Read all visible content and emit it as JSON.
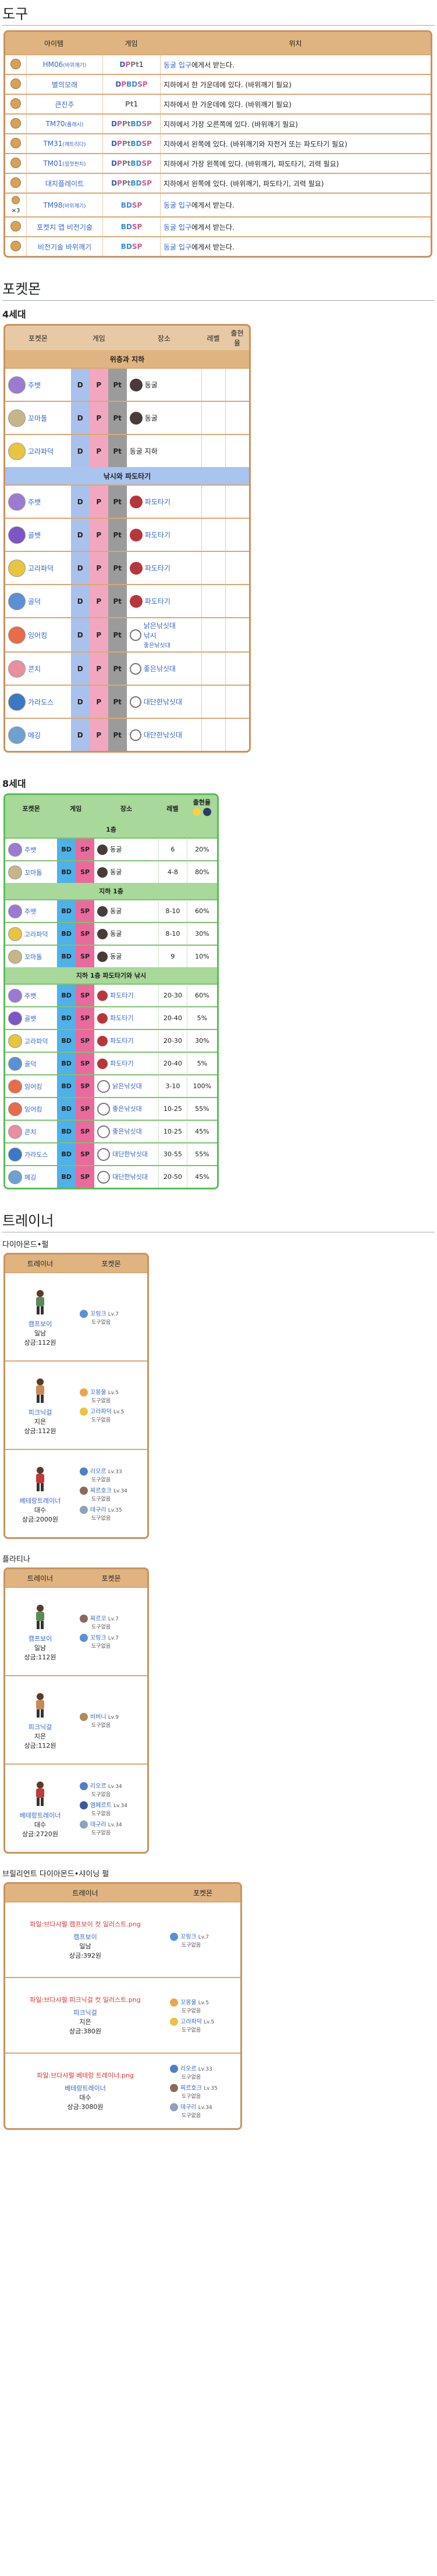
{
  "section_items": "도구",
  "items_table": {
    "headers": [
      "아이템",
      "게임",
      "위치"
    ],
    "rows": [
      {
        "name": "HM06",
        "sub": "(바위깨기)",
        "games": [
          {
            "g": "D",
            "c": "g-d"
          },
          {
            "g": "P",
            "c": "g-p"
          },
          {
            "g": "Pt",
            "c": "g-pt"
          },
          {
            "g": "1",
            "c": ""
          }
        ],
        "loc": "동굴 입구",
        "loc_link": "동굴입구",
        "loc_text": "에게서 받는다."
      },
      {
        "name": "별의모래",
        "sub": "",
        "games": [
          {
            "g": "D",
            "c": "g-d"
          },
          {
            "g": "P",
            "c": "g-p"
          },
          {
            "g": "BD",
            "c": "g-bd"
          },
          {
            "g": "SP",
            "c": "g-sp"
          }
        ],
        "loc_text": "지하에서 한 가운데에 있다. (바위깨기 필요)"
      },
      {
        "name": "큰진주",
        "sub": "",
        "games": [
          {
            "g": "Pt",
            "c": "g-pt"
          },
          {
            "g": "1",
            "c": ""
          }
        ],
        "loc_text": "지하에서 한 가운데에 있다. (바위깨기 필요)"
      },
      {
        "name": "TM70",
        "sub": "(플래시)",
        "games": [
          {
            "g": "D",
            "c": "g-d"
          },
          {
            "g": "P",
            "c": "g-p"
          },
          {
            "g": "Pt",
            "c": "g-pt"
          },
          {
            "g": "BD",
            "c": "g-bd"
          },
          {
            "g": "SP",
            "c": "g-sp"
          }
        ],
        "loc_text": "지하에서 가장 오른쪽에 있다. (바위깨기 필요)"
      },
      {
        "name": "TM31",
        "sub": "(깨트리다)",
        "games": [
          {
            "g": "D",
            "c": "g-d"
          },
          {
            "g": "P",
            "c": "g-p"
          },
          {
            "g": "Pt",
            "c": "g-pt"
          },
          {
            "g": "BD",
            "c": "g-bd"
          },
          {
            "g": "SP",
            "c": "g-sp"
          }
        ],
        "loc_text": "지하에서 왼쪽에 있다. (바위깨기와 자전거 또는 파도타기 필요)"
      },
      {
        "name": "TM01",
        "sub": "(힘껏펀치)",
        "games": [
          {
            "g": "D",
            "c": "g-d"
          },
          {
            "g": "P",
            "c": "g-p"
          },
          {
            "g": "Pt",
            "c": "g-pt"
          },
          {
            "g": "BD",
            "c": "g-bd"
          },
          {
            "g": "SP",
            "c": "g-sp"
          }
        ],
        "loc_text": "지하에서 가장 왼쪽에 있다. (바위깨기, 파도타기, 괴력 필요)"
      },
      {
        "name": "대지플레이트",
        "sub": "",
        "games": [
          {
            "g": "D",
            "c": "g-d"
          },
          {
            "g": "P",
            "c": "g-p"
          },
          {
            "g": "Pt",
            "c": "g-pt"
          },
          {
            "g": "BD",
            "c": "g-bd"
          },
          {
            "g": "SP",
            "c": "g-sp"
          }
        ],
        "loc_text": "지하에서 왼쪽에 있다. (바위깨기, 파도타기, 괴력 필요)"
      },
      {
        "name": "TM98",
        "sub": "(바위깨기)",
        "games": [
          {
            "g": "BD",
            "c": "g-bd"
          },
          {
            "g": "SP",
            "c": "g-sp"
          }
        ],
        "loc": "동굴 입구",
        "loc_text": "에게서 받는다.",
        "prefix": "×3"
      },
      {
        "name": "포켓치 앱 비전기술",
        "sub": "",
        "games": [
          {
            "g": "BD",
            "c": "g-bd"
          },
          {
            "g": "SP",
            "c": "g-sp"
          }
        ],
        "loc": "동굴 입구",
        "loc_text": "에게서 받는다."
      },
      {
        "name": "비전기술 바위깨기",
        "sub": "",
        "games": [
          {
            "g": "BD",
            "c": "g-bd"
          },
          {
            "g": "SP",
            "c": "g-sp"
          }
        ],
        "loc": "동굴 입구",
        "loc_text": "에게서 받는다."
      }
    ]
  },
  "section_pokemon": "포켓몬",
  "gen4_label": "4세대",
  "gen4_table": {
    "headers": [
      "포켓몬",
      "게임",
      "장소",
      "레벨",
      "출현율"
    ],
    "sections": [
      {
        "title": "위층과 지하",
        "style": "sec",
        "rows": [
          {
            "name": "주뱃",
            "color": "#9b7bd1",
            "loc": "동굴",
            "icon": "cave"
          },
          {
            "name": "꼬마돌",
            "color": "#c7b58a",
            "loc": "동굴",
            "icon": "cave"
          },
          {
            "name": "고라파덕",
            "color": "#e8c440",
            "loc": "동굴 지하",
            "icon": ""
          }
        ]
      },
      {
        "title": "낚시와 파도타기",
        "style": "sec2",
        "rows": [
          {
            "name": "주뱃",
            "color": "#9b7bd1",
            "loc": "파도타기",
            "icon": "hiker"
          },
          {
            "name": "골뱃",
            "color": "#7c55c7",
            "loc": "파도타기",
            "icon": "hiker"
          },
          {
            "name": "고라파덕",
            "color": "#e8c440",
            "loc": "파도타기",
            "icon": "hiker"
          },
          {
            "name": "골덕",
            "color": "#5b8fd6",
            "loc": "파도타기",
            "icon": "hiker"
          },
          {
            "name": "잉어킹",
            "color": "#e86b4a",
            "loc": "낡은낚싯대",
            "icon": "fish",
            "extra": "낚시",
            "extra_sub": "좋은낚싯대"
          },
          {
            "name": "콘치",
            "color": "#e88fa0",
            "loc": "좋은낚싯대",
            "icon": "fish"
          },
          {
            "name": "가라도스",
            "color": "#3d78c4",
            "loc": "대단한낚싯대",
            "icon": "fish"
          },
          {
            "name": "메깅",
            "color": "#6fa0cf",
            "loc": "대단한낚싯대",
            "icon": "fish"
          }
        ]
      }
    ]
  },
  "gen8_label": "8세대",
  "gen8_table": {
    "headers": [
      "포켓몬",
      "게임",
      "장소",
      "레벨",
      "출현율"
    ],
    "sections": [
      {
        "title": "1층",
        "rows": [
          {
            "name": "주뱃",
            "color": "#9b7bd1",
            "loc": "동굴",
            "icon": "cave",
            "level": "6",
            "rate": "20%"
          },
          {
            "name": "꼬마돌",
            "color": "#c7b58a",
            "loc": "동굴",
            "icon": "cave",
            "level": "4-8",
            "rate": "80%"
          }
        ]
      },
      {
        "title": "지하 1층",
        "rows": [
          {
            "name": "주뱃",
            "color": "#9b7bd1",
            "loc": "동굴",
            "icon": "cave",
            "level": "8-10",
            "rate": "60%"
          },
          {
            "name": "고라파덕",
            "color": "#e8c440",
            "loc": "동굴",
            "icon": "cave",
            "level": "8-10",
            "rate": "30%"
          },
          {
            "name": "꼬마돌",
            "color": "#c7b58a",
            "loc": "동굴",
            "icon": "cave",
            "level": "9",
            "rate": "10%"
          }
        ]
      },
      {
        "title": "지하 1층 파도타기와 낚시",
        "rows": [
          {
            "name": "주뱃",
            "color": "#9b7bd1",
            "loc": "파도타기",
            "icon": "hiker",
            "level": "20-30",
            "rate": "60%"
          },
          {
            "name": "골뱃",
            "color": "#7c55c7",
            "loc": "파도타기",
            "icon": "hiker",
            "level": "20-40",
            "rate": "5%"
          },
          {
            "name": "고라파덕",
            "color": "#e8c440",
            "loc": "파도타기",
            "icon": "hiker",
            "level": "20-30",
            "rate": "30%"
          },
          {
            "name": "골덕",
            "color": "#5b8fd6",
            "loc": "파도타기",
            "icon": "hiker",
            "level": "20-40",
            "rate": "5%"
          },
          {
            "name": "잉어킹",
            "color": "#e86b4a",
            "loc": "낡은낚싯대",
            "icon": "fish",
            "level": "3-10",
            "rate": "100%"
          },
          {
            "name": "잉어킹",
            "color": "#e86b4a",
            "loc": "좋은낚싯대",
            "icon": "fish",
            "level": "10-25",
            "rate": "55%"
          },
          {
            "name": "콘치",
            "color": "#e88fa0",
            "loc": "좋은낚싯대",
            "icon": "fish",
            "level": "10-25",
            "rate": "45%"
          },
          {
            "name": "가라도스",
            "color": "#3d78c4",
            "loc": "대단한낚싯대",
            "icon": "fish",
            "level": "30-55",
            "rate": "55%"
          },
          {
            "name": "메깅",
            "color": "#6fa0cf",
            "loc": "대단한낚싯대",
            "icon": "fish",
            "level": "20-50",
            "rate": "45%"
          }
        ]
      }
    ]
  },
  "section_trainers": "트레이너",
  "dp_label": "다이아몬드•펄",
  "pt_label": "플라티나",
  "bdsp_label": "브릴리언트 다이아몬드•샤이닝 펄",
  "trainer_headers": [
    "트레이너",
    "포켓몬"
  ],
  "dp_trainers": [
    {
      "class": "캠프보이",
      "name": "일남",
      "reward": "상금:112원",
      "sprite": "#5b8a5a",
      "mons": [
        {
          "name": "꼬링크",
          "lv": "Lv.7",
          "color": "#5b8fd6"
        }
      ]
    },
    {
      "class": "피크닉걸",
      "name": "지은",
      "reward": "상금:112원",
      "sprite": "#c98a5a",
      "mons": [
        {
          "name": "꼬몽울",
          "lv": "Lv.5",
          "color": "#e8a84a"
        },
        {
          "name": "고라파덕",
          "lv": "Lv.5",
          "color": "#e8c440"
        }
      ]
    },
    {
      "class": "베테랑트레이너",
      "name": "대수",
      "reward": "상금:2000원",
      "sprite": "#c03a3a",
      "mons": [
        {
          "name": "리오르",
          "lv": "Lv.33",
          "color": "#4f7fc9"
        },
        {
          "name": "찌르호크",
          "lv": "Lv.34",
          "color": "#8c6a5a"
        },
        {
          "name": "데구리",
          "lv": "Lv.35",
          "color": "#8fa0c0"
        }
      ]
    }
  ],
  "pt_trainers": [
    {
      "class": "캠프보이",
      "name": "일남",
      "reward": "상금:112원",
      "sprite": "#5b8a5a",
      "mons": [
        {
          "name": "찌르꼬",
          "lv": "Lv.7",
          "color": "#8c6a5a"
        },
        {
          "name": "꼬링크",
          "lv": "Lv.7",
          "color": "#5b8fd6"
        }
      ]
    },
    {
      "class": "피크닉걸",
      "name": "지은",
      "reward": "상금:112원",
      "sprite": "#c98a5a",
      "mons": [
        {
          "name": "비버니",
          "lv": "Lv.9",
          "color": "#b08a5a"
        }
      ]
    },
    {
      "class": "베테랑트레이너",
      "name": "대수",
      "reward": "상금:2720원",
      "sprite": "#c03a3a",
      "mons": [
        {
          "name": "리오르",
          "lv": "Lv.34",
          "color": "#4f7fc9"
        },
        {
          "name": "엠페르트",
          "lv": "Lv.34",
          "color": "#3a5aa0"
        },
        {
          "name": "데구리",
          "lv": "Lv.34",
          "color": "#8fa0c0"
        }
      ]
    }
  ],
  "bdsp_trainers": [
    {
      "file": "파일:브다샤펄 캠프보이 컷 일러스트.png",
      "class": "캠프보이",
      "name": "일남",
      "reward": "상금:392원",
      "mons": [
        {
          "name": "꼬링크",
          "lv": "Lv.7",
          "color": "#5b8fd6"
        }
      ]
    },
    {
      "file": "파일:브다샤펄 피크닉걸 컷 일러스트.png",
      "class": "피크닉걸",
      "name": "지은",
      "reward": "상금:380원",
      "mons": [
        {
          "name": "꼬몽울",
          "lv": "Lv.5",
          "color": "#e8a84a"
        },
        {
          "name": "고라파덕",
          "lv": "Lv.5",
          "color": "#e8c440"
        }
      ]
    },
    {
      "file": "파일:브다샤펄 베테랑 트레이너.png",
      "class": "베테랑트레이너",
      "name": "대수",
      "reward": "상금:3080원",
      "mons": [
        {
          "name": "리오르",
          "lv": "Lv.33",
          "color": "#4f7fc9"
        },
        {
          "name": "찌르호크",
          "lv": "Lv.35",
          "color": "#8c6a5a"
        },
        {
          "name": "데구리",
          "lv": "Lv.34",
          "color": "#8fa0c0"
        }
      ]
    }
  ],
  "mon_sub": "도구없음"
}
